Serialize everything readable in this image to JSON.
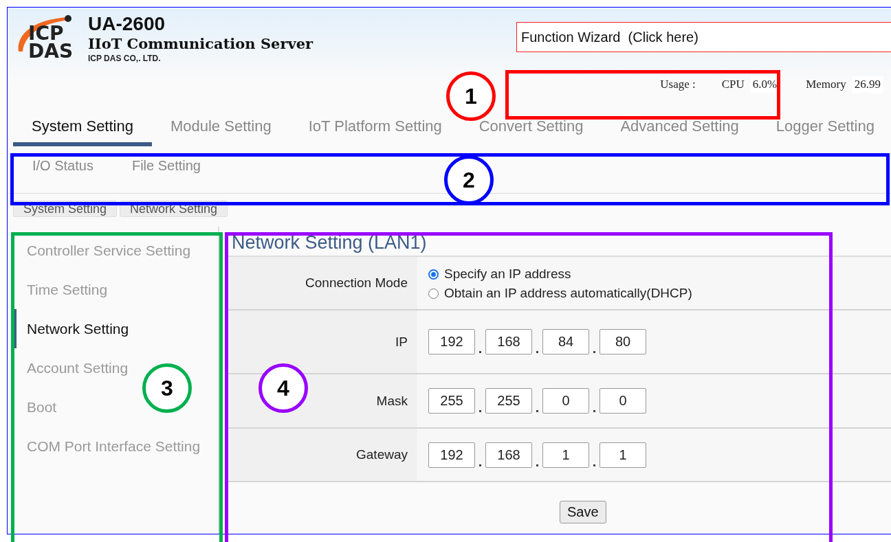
{
  "header": {
    "logo": [
      "ICP",
      "DAS"
    ],
    "model": "UA-2600",
    "product": "IIoT Communication Server",
    "company": "ICP DAS CO,. LTD."
  },
  "wizard": {
    "label": "Function Wizard  (Click here)"
  },
  "usage": {
    "label": "Usage :",
    "cpu_label": "CPU",
    "cpu": "6.0%",
    "memory_label": "Memory",
    "memory": "26.99"
  },
  "tabs": [
    {
      "label": "System Setting",
      "selected": true
    },
    {
      "label": "Module Setting",
      "selected": false
    },
    {
      "label": "IoT Platform Setting",
      "selected": false
    },
    {
      "label": "Convert Setting",
      "selected": false
    },
    {
      "label": "Advanced Setting",
      "selected": false
    },
    {
      "label": "Logger Setting",
      "selected": false
    }
  ],
  "subtabs": [
    "I/O Status",
    "File Setting"
  ],
  "breadcrumb": [
    "System Setting",
    "Network Setting"
  ],
  "sidebar": {
    "items": [
      {
        "label": "Controller Service Setting",
        "selected": false
      },
      {
        "label": "Time Setting",
        "selected": false
      },
      {
        "label": "Network Setting",
        "selected": true
      },
      {
        "label": "Account Setting",
        "selected": false
      },
      {
        "label": "Boot",
        "selected": false
      },
      {
        "label": "COM Port Interface Setting",
        "selected": false
      }
    ]
  },
  "form": {
    "title": "Network Setting (LAN1)",
    "rows": [
      {
        "kind": "radio",
        "label": "Connection Mode",
        "options": [
          {
            "label": "Specify an IP address",
            "selected": true
          },
          {
            "label": "Obtain an IP address automatically(DHCP)",
            "selected": false
          }
        ]
      },
      {
        "kind": "ip",
        "label": "IP",
        "octets": [
          "192",
          "168",
          "84",
          "80"
        ]
      },
      {
        "kind": "ip",
        "label": "Mask",
        "octets": [
          "255",
          "255",
          "0",
          "0"
        ]
      },
      {
        "kind": "ip",
        "label": "Gateway",
        "octets": [
          "192",
          "168",
          "1",
          "1"
        ]
      }
    ],
    "save": "Save"
  },
  "annotations": [
    {
      "number": "1",
      "color": "#ff0000"
    },
    {
      "number": "2",
      "color": "#0000ff"
    },
    {
      "number": "3",
      "color": "#00b050"
    },
    {
      "number": "4",
      "color": "#9900ff"
    }
  ]
}
